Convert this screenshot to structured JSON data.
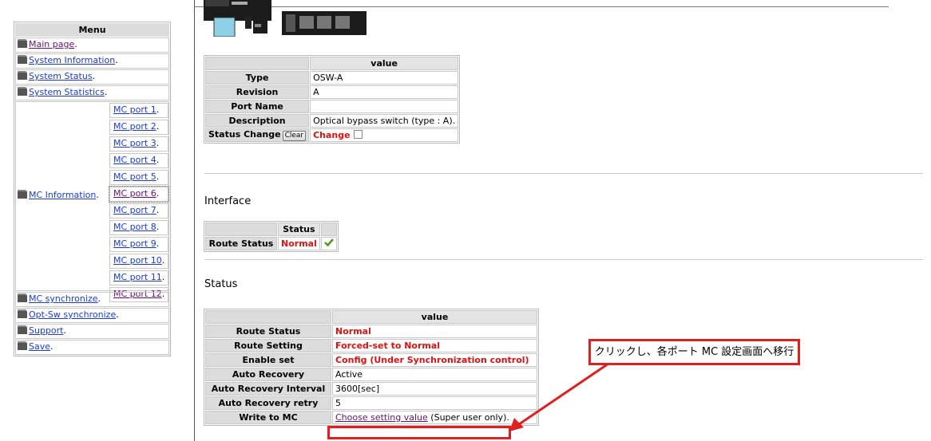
{
  "menu": {
    "title": "Menu",
    "items_top": [
      "Main page",
      "System Information",
      "System Status",
      "System Statistics"
    ],
    "mc_information": "MC Information",
    "ports": [
      "MC port 1",
      "MC port 2",
      "MC port 3",
      "MC port 4",
      "MC port 5",
      "MC port 6",
      "MC port 7",
      "MC port 8",
      "MC port 9",
      "MC port 10",
      "MC port 11",
      "MC port 12"
    ],
    "items_bottom": [
      "MC synchronize",
      "Opt-Sw synchronize",
      "Support",
      "Save"
    ]
  },
  "info": {
    "header_value": "value",
    "type_label": "Type",
    "type_value": "OSW-A",
    "revision_label": "Revision",
    "revision_value": "A",
    "port_name_label": "Port Name",
    "port_name_value": "",
    "description_label": "Description",
    "description_value": "Optical bypass switch (type : A).",
    "status_change_label": "Status Change",
    "clear_button": "Clear",
    "change_label": "Change"
  },
  "interface": {
    "title": "Interface",
    "status_header": "Status",
    "route_status_label": "Route Status",
    "route_status_value": "Normal"
  },
  "status": {
    "title": "Status",
    "header_value": "value",
    "rows": [
      {
        "label": "Route Status",
        "value": "Normal"
      },
      {
        "label": "Route Setting",
        "value": "Forced-set to Normal"
      },
      {
        "label": "Enable set",
        "value": "Config (Under Synchronization control)"
      },
      {
        "label": "Auto Recovery",
        "value": "Active"
      },
      {
        "label": "Auto Recovery Interval",
        "value": "3600[sec]"
      },
      {
        "label": "Auto Recovery retry",
        "value": "5"
      },
      {
        "label": "Write to MC",
        "link": "Choose setting value",
        "note": "(Super user only)."
      }
    ]
  },
  "annotation": {
    "callout_text": "クリックし、各ポート MC 設定画面へ移行",
    "color": "#e02020"
  }
}
